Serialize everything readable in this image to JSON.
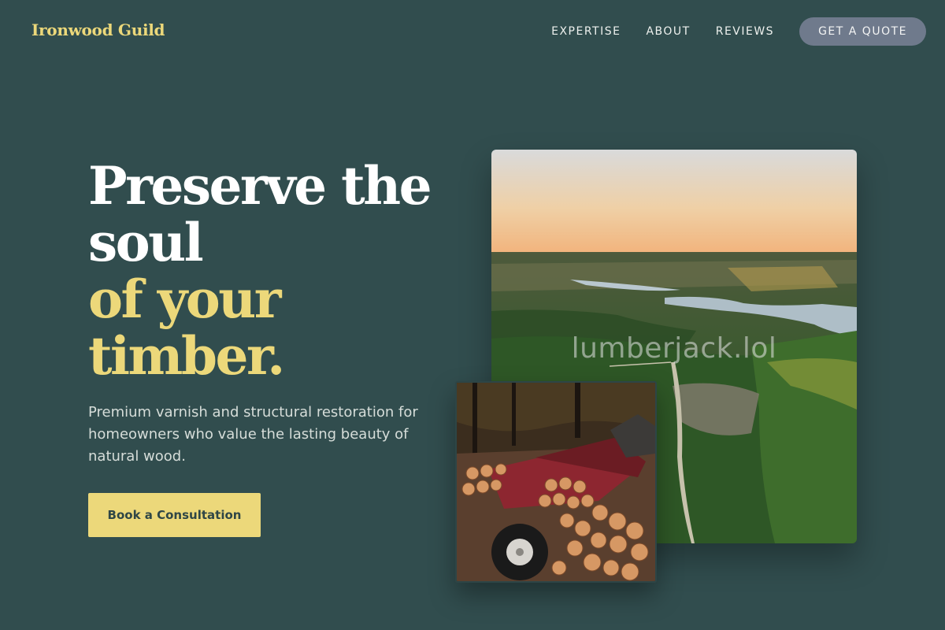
{
  "header": {
    "brand": "Ironwood Guild",
    "nav": [
      "EXPERTISE",
      "ABOUT",
      "REVIEWS"
    ],
    "quote_button": "GET A QUOTE"
  },
  "hero": {
    "headline_line1": "Preserve the soul",
    "headline_line2": "of your timber.",
    "description": "Premium varnish and structural restoration for homeowners who value the lasting beauty of natural wood.",
    "cta_label": "Book a Consultation"
  },
  "images": {
    "main_watermark": "lumberjack.lol",
    "main_subject": "aerial-forest-landscape",
    "secondary_subject": "log-pile-with-red-tractor"
  },
  "colors": {
    "background": "#314d4e",
    "accent_yellow": "#ecd87a",
    "nav_button": "#6f7a8c",
    "text_light": "#d6ddd9"
  }
}
